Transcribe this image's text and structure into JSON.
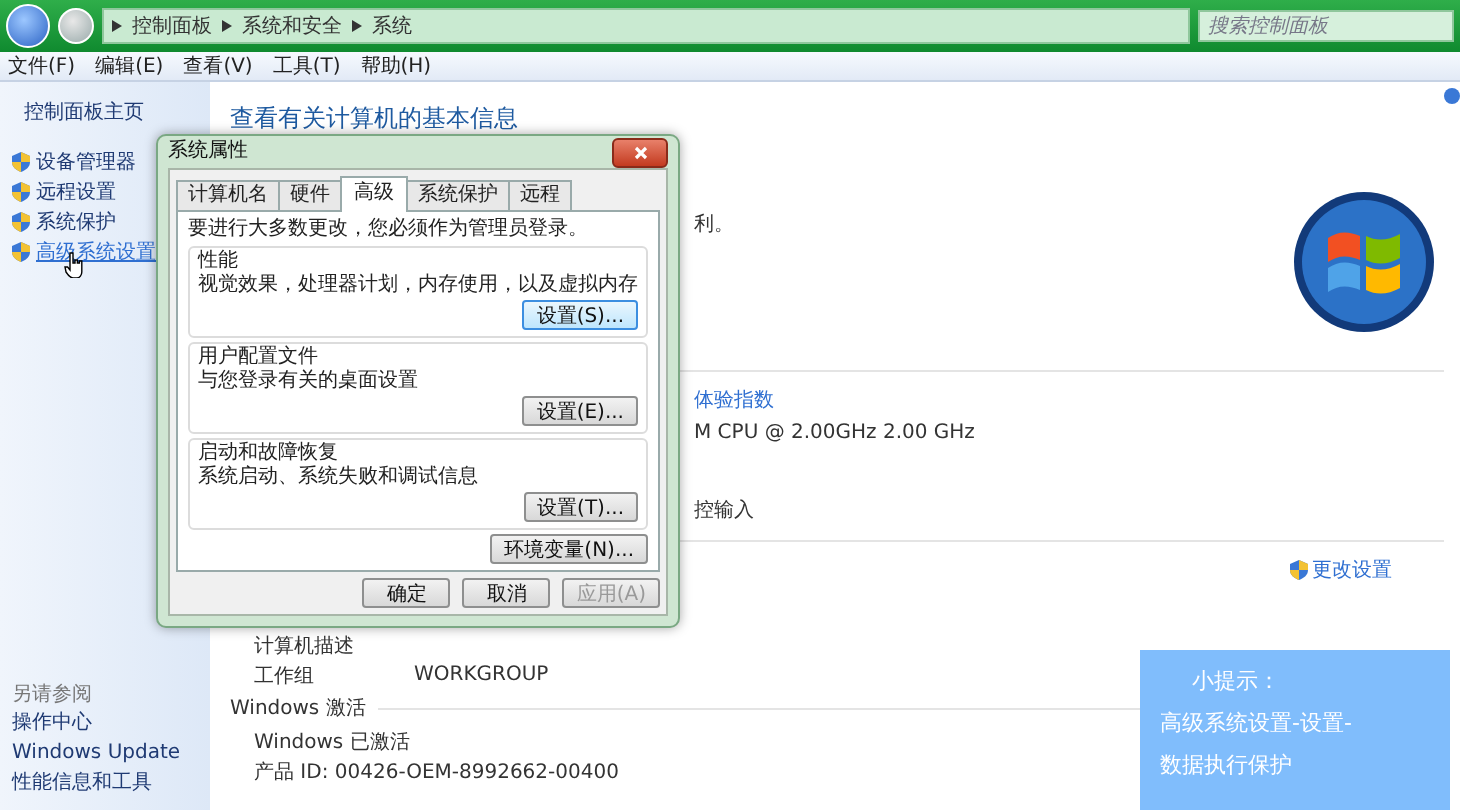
{
  "window": {
    "breadcrumb": [
      "控制面板",
      "系统和安全",
      "系统"
    ],
    "search": {
      "placeholder": "搜索控制面板"
    },
    "menu": [
      "文件(F)",
      "编辑(E)",
      "查看(V)",
      "工具(T)",
      "帮助(H)"
    ]
  },
  "sidebar": {
    "home": "控制面板主页",
    "items": [
      {
        "label": "设备管理器",
        "hovered": false
      },
      {
        "label": "远程设置",
        "hovered": false
      },
      {
        "label": "系统保护",
        "hovered": false
      },
      {
        "label": "高级系统设置",
        "hovered": true
      }
    ],
    "see_also": {
      "heading": "另请参阅",
      "links": [
        "操作中心",
        "Windows Update",
        "性能信息和工具"
      ]
    }
  },
  "main": {
    "title": "查看有关计算机的基本信息",
    "copyright_tail": "利。",
    "rating_link": "体验指数",
    "processor_tail": "M CPU @ 2.00GHz   2.00 GHz",
    "pen_tail": "控输入",
    "change_settings": "更改设置",
    "computer_rows": [
      {
        "label": "计算机描述"
      },
      {
        "label": "工作组",
        "value": "WORKGROUP"
      }
    ],
    "activation": {
      "heading": "Windows 激活",
      "status": "Windows 已激活",
      "product_id": "产品 ID: 00426-OEM-8992662-00400"
    }
  },
  "dialog": {
    "title": "系统属性",
    "tabs": [
      {
        "label": "计算机名",
        "selected": false
      },
      {
        "label": "硬件",
        "selected": false
      },
      {
        "label": "高级",
        "selected": true
      },
      {
        "label": "系统保护",
        "selected": false
      },
      {
        "label": "远程",
        "selected": false
      }
    ],
    "note": "要进行大多数更改，您必须作为管理员登录。",
    "groups": [
      {
        "title": "性能",
        "text": "视觉效果，处理器计划，内存使用，以及虚拟内存",
        "button": "设置(S)...",
        "focused": true
      },
      {
        "title": "用户配置文件",
        "text": "与您登录有关的桌面设置",
        "button": "设置(E)...",
        "focused": false
      },
      {
        "title": "启动和故障恢复",
        "text": "系统启动、系统失败和调试信息",
        "button": "设置(T)...",
        "focused": false
      }
    ],
    "env_button": "环境变量(N)...",
    "buttons": [
      {
        "label": "确定",
        "disabled": false
      },
      {
        "label": "取消",
        "disabled": false
      },
      {
        "label": "应用(A)",
        "disabled": true
      }
    ]
  },
  "tip": {
    "title": "小提示：",
    "lines": [
      "高级系统设置-设置-",
      "数据执行保护"
    ]
  }
}
